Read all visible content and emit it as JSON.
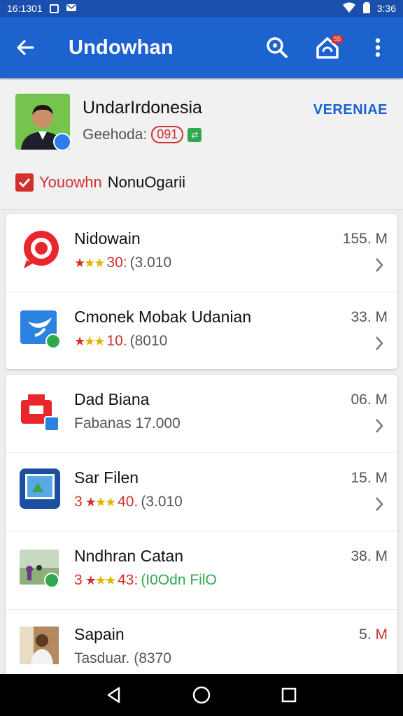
{
  "status_bar": {
    "time_left": "16:1301",
    "time_right": "3:36"
  },
  "app_bar": {
    "title": "Undowhan",
    "badge_count": "55"
  },
  "profile": {
    "name": "UndarIrdonesia",
    "verified_label": "VERENIAE",
    "subtitle": "Geehoda:",
    "chip": "091",
    "link_highlight": "Youowhn",
    "link_rest": "NonuOgarii"
  },
  "apps": [
    {
      "name": "Nidowain",
      "rating": "30:",
      "reviews": "(3.010",
      "size": "155. M",
      "icon": "chat-bubble-icon"
    },
    {
      "name": "Cmonek Mobak Udanian",
      "rating": "10.",
      "reviews": "(8010",
      "size": "33. M",
      "icon": "bird-icon"
    },
    {
      "name": "Dad Biana",
      "rating": "",
      "reviews": "Fabanas  17.000",
      "size": "06. M",
      "icon": "printer-icon"
    },
    {
      "name": "Sar Filen",
      "rating": "3",
      "rating_tail": "40.",
      "reviews": "(3.010",
      "size": "15. M",
      "icon": "photo-frame-icon"
    },
    {
      "name": "Nndhran Catan",
      "rating": "3",
      "rating_tail": "43:",
      "reviews": "(I0Odn FilO",
      "size": "38. M",
      "icon": "photo-icon"
    },
    {
      "name": "Sapain",
      "rating": "",
      "reviews": "Tasduar. (8370",
      "size": "5.",
      "size_unit": "M",
      "icon": "person-photo-icon"
    }
  ],
  "colors": {
    "primary": "#1c63cf",
    "status": "#1a4fae",
    "accent_red": "#d32f2f",
    "star": "#e0b400",
    "green": "#2fa84f"
  }
}
